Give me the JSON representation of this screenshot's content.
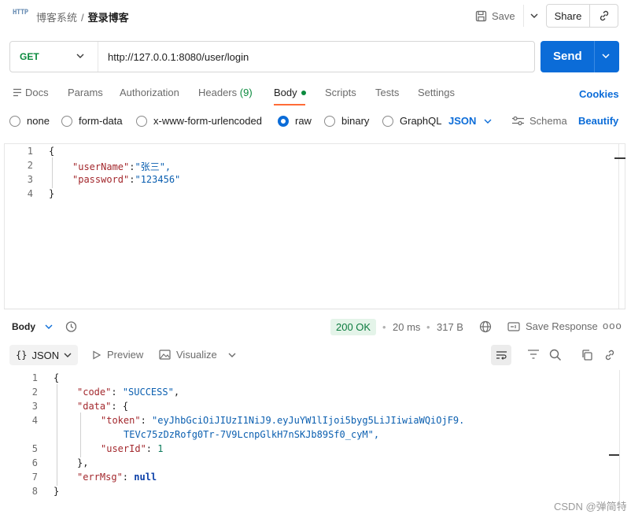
{
  "header": {
    "app_icon": "http-icon",
    "app_icon_text": "HTTP",
    "breadcrumb_parent": "博客系统",
    "breadcrumb_sep": "/",
    "breadcrumb_current": "登录博客",
    "save_label": "Save",
    "share_label": "Share"
  },
  "request": {
    "method": "GET",
    "url": "http://127.0.0.1:8080/user/login",
    "send_label": "Send"
  },
  "tabs": [
    {
      "label": "Docs"
    },
    {
      "label": "Params"
    },
    {
      "label": "Authorization"
    },
    {
      "label": "Headers",
      "count": "(9)"
    },
    {
      "label": "Body",
      "active": true
    },
    {
      "label": "Scripts"
    },
    {
      "label": "Tests"
    },
    {
      "label": "Settings"
    }
  ],
  "cookies_label": "Cookies",
  "body_types": [
    {
      "label": "none",
      "selected": false
    },
    {
      "label": "form-data",
      "selected": false
    },
    {
      "label": "x-www-form-urlencoded",
      "selected": false
    },
    {
      "label": "raw",
      "selected": true
    },
    {
      "label": "binary",
      "selected": false
    },
    {
      "label": "GraphQL",
      "selected": false
    }
  ],
  "raw_format": "JSON",
  "schema_label": "Schema",
  "beautify_label": "Beautify",
  "request_body_lines": [
    {
      "n": "1",
      "text": "{"
    },
    {
      "n": "2",
      "key": "\"userName\"",
      "val": "\"张三\","
    },
    {
      "n": "3",
      "key": "\"password\"",
      "val": "\"123456\""
    },
    {
      "n": "4",
      "text": "}"
    }
  ],
  "response": {
    "section_label": "Body",
    "status": "200 OK",
    "time": "20 ms",
    "size": "317 B",
    "save_response_label": "Save Response",
    "more_label": "ooo",
    "format_label": "JSON",
    "format_prefix": "{}",
    "preview_label": "Preview",
    "visualize_label": "Visualize",
    "lines": [
      {
        "n": "1",
        "text": "{"
      },
      {
        "n": "2",
        "key": "\"code\"",
        "val": "\"SUCCESS\""
      },
      {
        "n": "3",
        "key": "\"data\"",
        "val": "{"
      },
      {
        "n": "4",
        "key": "\"token\"",
        "val": "\"eyJhbGciOiJIUzI1NiJ9.eyJuYW1lIjoi5byg5LiJIiwiaWQiOjF9.",
        "cont": "TEVc75zDzRofg0Tr-7V9LcnpGlkH7nSKJb89Sf0_cyM\","
      },
      {
        "n": "5",
        "key": "\"userId\"",
        "val": "1"
      },
      {
        "n": "6",
        "text": "},"
      },
      {
        "n": "7",
        "key": "\"errMsg\"",
        "val": "null"
      },
      {
        "n": "8",
        "text": "}"
      }
    ]
  },
  "watermark": "CSDN @弹简特",
  "colors": {
    "send": "#0b6cd8",
    "accent": "#ff6c37",
    "status_ok": "#0b7a3e",
    "link": "#0b6cd8"
  }
}
